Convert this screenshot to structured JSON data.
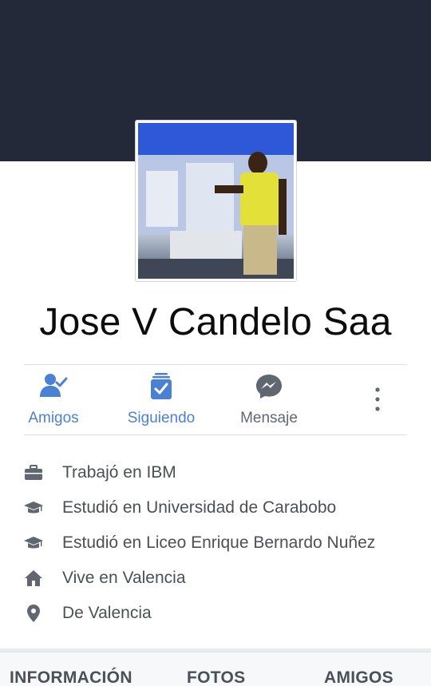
{
  "profile": {
    "name": "Jose V Candelo Saa"
  },
  "actions": [
    {
      "label": "Amigos",
      "icon": "friends-check-icon"
    },
    {
      "label": "Siguiendo",
      "icon": "following-check-icon"
    },
    {
      "label": "Mensaje",
      "icon": "messenger-icon"
    },
    {
      "label": "",
      "icon": "more-options-icon"
    }
  ],
  "intro": [
    {
      "icon": "briefcase-icon",
      "text": "Trabajó en IBM"
    },
    {
      "icon": "graduation-cap-icon",
      "text": "Estudió en Universidad de Carabobo"
    },
    {
      "icon": "graduation-cap-icon",
      "text": "Estudió en Liceo Enrique Bernardo Nuñez"
    },
    {
      "icon": "home-icon",
      "text": "Vive en Valencia"
    },
    {
      "icon": "location-pin-icon",
      "text": "De Valencia"
    }
  ],
  "tabs": [
    {
      "label": "INFORMACIÓN"
    },
    {
      "label": "FOTOS"
    },
    {
      "label": "AMIGOS"
    }
  ],
  "colors": {
    "cover": "#232938",
    "accent": "#4a81d4",
    "icon_gray": "#616770",
    "text_gray": "#4b4f56"
  }
}
